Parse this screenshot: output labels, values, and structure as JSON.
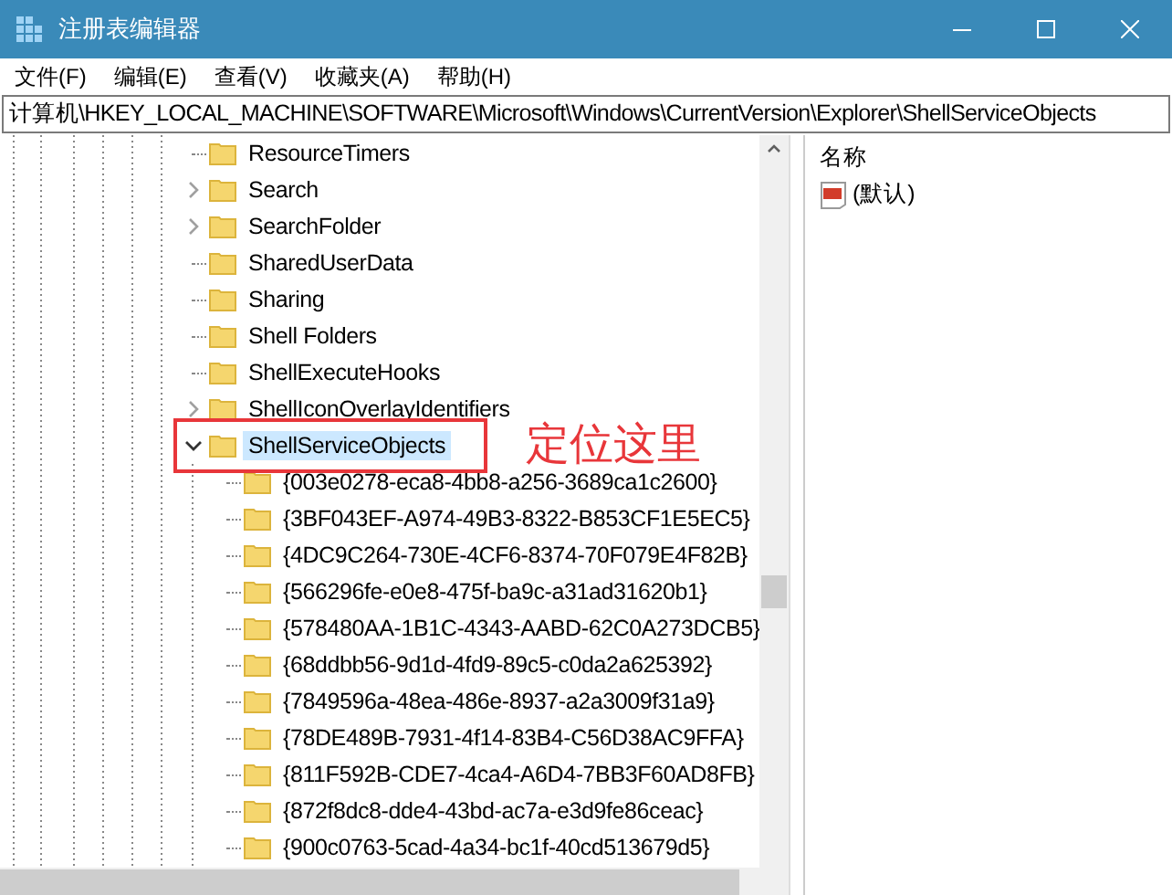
{
  "window": {
    "title": "注册表编辑器"
  },
  "menu": [
    {
      "label": "文件(F)"
    },
    {
      "label": "编辑(E)"
    },
    {
      "label": "查看(V)"
    },
    {
      "label": "收藏夹(A)"
    },
    {
      "label": "帮助(H)"
    }
  ],
  "address": {
    "value": "计算机\\HKEY_LOCAL_MACHINE\\SOFTWARE\\Microsoft\\Windows\\CurrentVersion\\Explorer\\ShellServiceObjects"
  },
  "tree": {
    "items": [
      {
        "label": "ResourceTimers",
        "expandable": false,
        "selected": false,
        "annotated": false
      },
      {
        "label": "Search",
        "expandable": true,
        "expanded": false,
        "selected": false,
        "annotated": false
      },
      {
        "label": "SearchFolder",
        "expandable": true,
        "expanded": false,
        "selected": false,
        "annotated": false
      },
      {
        "label": "SharedUserData",
        "expandable": false,
        "selected": false,
        "annotated": false
      },
      {
        "label": "Sharing",
        "expandable": false,
        "selected": false,
        "annotated": false
      },
      {
        "label": "Shell Folders",
        "expandable": false,
        "selected": false,
        "annotated": false
      },
      {
        "label": "ShellExecuteHooks",
        "expandable": false,
        "selected": false,
        "annotated": false
      },
      {
        "label": "ShellIconOverlayIdentifiers",
        "expandable": true,
        "expanded": false,
        "selected": false,
        "annotated": false
      },
      {
        "label": "ShellServiceObjects",
        "expandable": true,
        "expanded": true,
        "selected": true,
        "annotated": true,
        "children": [
          {
            "label": "{003e0278-eca8-4bb8-a256-3689ca1c2600}",
            "expandable": false,
            "selected": false,
            "annotated": false
          },
          {
            "label": "{3BF043EF-A974-49B3-8322-B853CF1E5EC5}",
            "expandable": false,
            "selected": false,
            "annotated": false
          },
          {
            "label": "{4DC9C264-730E-4CF6-8374-70F079E4F82B}",
            "expandable": false,
            "selected": false,
            "annotated": false
          },
          {
            "label": "{566296fe-e0e8-475f-ba9c-a31ad31620b1}",
            "expandable": false,
            "selected": false,
            "annotated": false
          },
          {
            "label": "{578480AA-1B1C-4343-AABD-62C0A273DCB5}",
            "expandable": false,
            "selected": false,
            "annotated": false
          },
          {
            "label": "{68ddbb56-9d1d-4fd9-89c5-c0da2a625392}",
            "expandable": false,
            "selected": false,
            "annotated": false
          },
          {
            "label": "{7849596a-48ea-486e-8937-a2a3009f31a9}",
            "expandable": false,
            "selected": false,
            "annotated": false
          },
          {
            "label": "{78DE489B-7931-4f14-83B4-C56D38AC9FFA}",
            "expandable": false,
            "selected": false,
            "annotated": false
          },
          {
            "label": "{811F592B-CDE7-4ca4-A6D4-7BB3F60AD8FB}",
            "expandable": false,
            "selected": false,
            "annotated": false
          },
          {
            "label": "{872f8dc8-dde4-43bd-ac7a-e3d9fe86ceac}",
            "expandable": false,
            "selected": false,
            "annotated": false
          },
          {
            "label": "{900c0763-5cad-4a34-bc1f-40cd513679d5}",
            "expandable": false,
            "selected": false,
            "annotated": false
          }
        ]
      }
    ]
  },
  "annotation": {
    "label": "定位这里"
  },
  "values": {
    "columns": [
      {
        "label": "名称"
      }
    ],
    "rows": [
      {
        "name": "(默认)"
      }
    ]
  }
}
